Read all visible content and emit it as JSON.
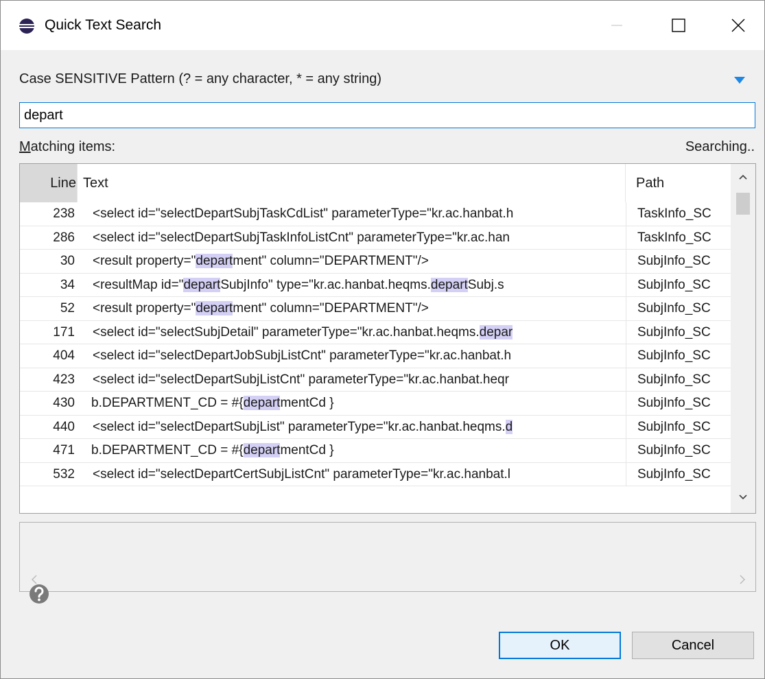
{
  "window": {
    "title": "Quick Text Search",
    "icon": "eclipse-icon"
  },
  "pattern": {
    "label": "Case SENSITIVE Pattern (? = any character, * = any string)",
    "value": "depart"
  },
  "matching": {
    "label_prefix": "M",
    "label_rest": "atching items:",
    "status": "Searching.."
  },
  "table": {
    "columns": [
      "Line",
      "Text",
      "Path"
    ],
    "rows": [
      {
        "line": "238",
        "text": [
          "<select id=\"selectDepartSubjTaskCdList\" parameterType=\"kr.ac.hanbat.h"
        ],
        "path": "TaskInfo_SC"
      },
      {
        "line": "286",
        "text": [
          "<select id=\"selectDepartSubjTaskInfoListCnt\" parameterType=\"kr.ac.han"
        ],
        "path": "TaskInfo_SC"
      },
      {
        "line": "30",
        "text": [
          "<result property=\"",
          "#depart",
          "ment\" column=\"DEPARTMENT\"/>"
        ],
        "path": "SubjInfo_SC"
      },
      {
        "line": "34",
        "text": [
          "<resultMap id=\"",
          "#depart",
          "SubjInfo\" type=\"kr.ac.hanbat.heqms.",
          "#depart",
          "Subj.s"
        ],
        "path": "SubjInfo_SC"
      },
      {
        "line": "52",
        "text": [
          "<result property=\"",
          "#depart",
          "ment\" column=\"DEPARTMENT\"/>"
        ],
        "path": "SubjInfo_SC"
      },
      {
        "line": "171",
        "text": [
          "<select id=\"selectSubjDetail\" parameterType=\"kr.ac.hanbat.heqms.",
          "#depar"
        ],
        "path": "SubjInfo_SC"
      },
      {
        "line": "404",
        "text": [
          "<select id=\"selectDepartJobSubjListCnt\" parameterType=\"kr.ac.hanbat.h"
        ],
        "path": "SubjInfo_SC"
      },
      {
        "line": "423",
        "text": [
          "<select id=\"selectDepartSubjListCnt\" parameterType=\"kr.ac.hanbat.heqr"
        ],
        "path": "SubjInfo_SC"
      },
      {
        "line": "430",
        "text": [
          "b.DEPARTMENT_CD = #{",
          "#depart",
          "mentCd }"
        ],
        "path": "SubjInfo_SC"
      },
      {
        "line": "440",
        "text": [
          "<select id=\"selectDepartSubjList\" parameterType=\"kr.ac.hanbat.heqms.",
          "#d"
        ],
        "path": "SubjInfo_SC"
      },
      {
        "line": "471",
        "text": [
          "b.DEPARTMENT_CD = #{",
          "#depart",
          "mentCd }"
        ],
        "path": "SubjInfo_SC"
      },
      {
        "line": "532",
        "text": [
          "<select id=\"selectDepartCertSubjListCnt\" parameterType=\"kr.ac.hanbat.l"
        ],
        "path": "SubjInfo_SC"
      }
    ],
    "text_indent": [
      true,
      true,
      true,
      true,
      true,
      true,
      true,
      true,
      false,
      true,
      false,
      true
    ]
  },
  "buttons": {
    "ok": "OK",
    "cancel": "Cancel"
  },
  "colors": {
    "accent": "#0078d7",
    "match_highlight": "#d4d0f5"
  }
}
